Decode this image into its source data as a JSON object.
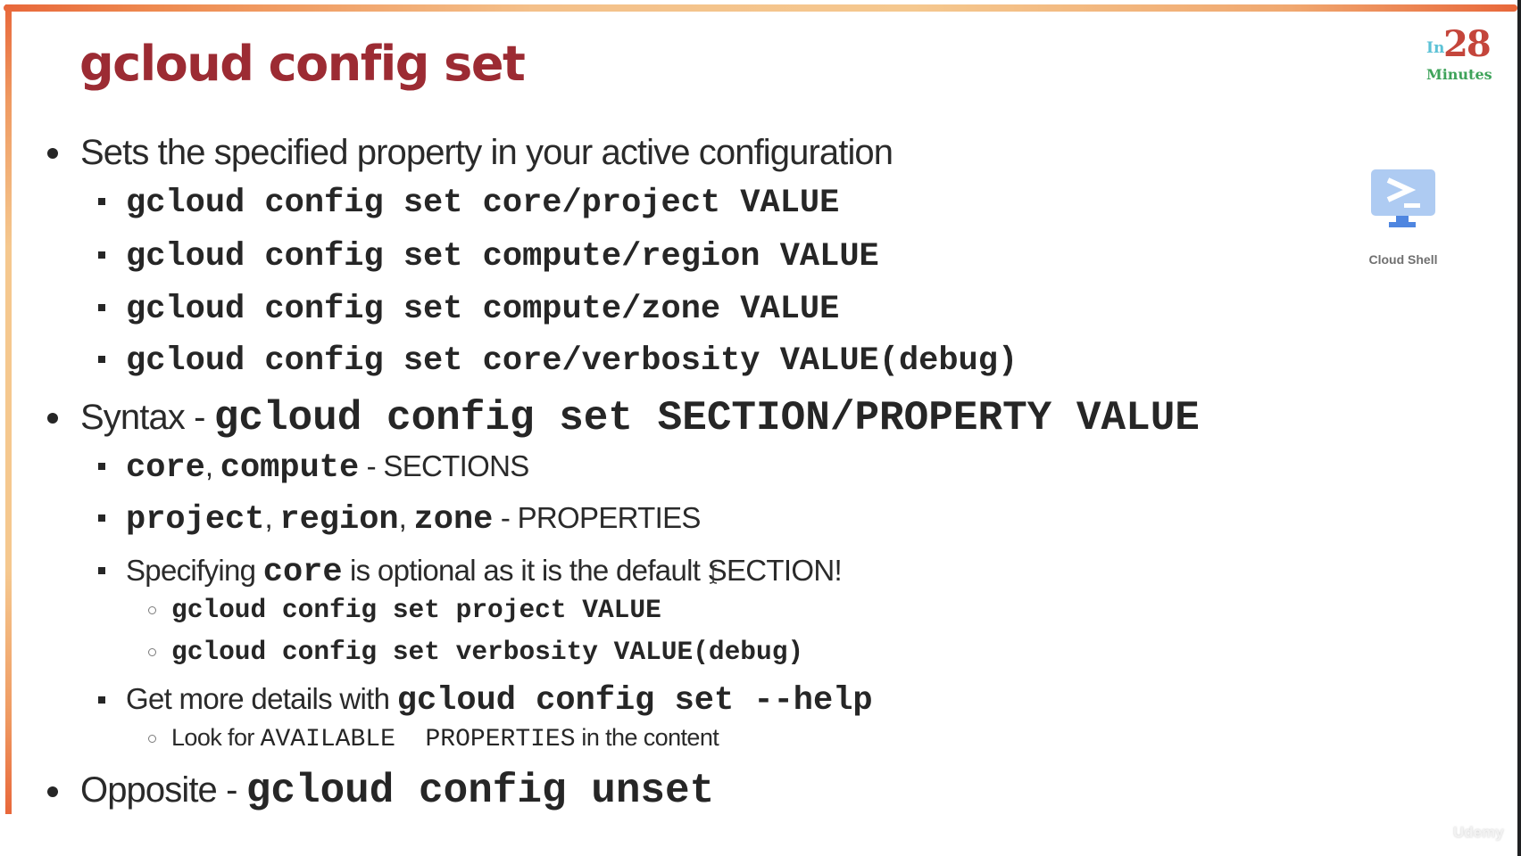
{
  "slide": {
    "title": "gcloud config set",
    "logo": {
      "prefix": "In",
      "number": "28",
      "suffix": "Minutes"
    },
    "cloud_shell": {
      "icon": "cloud-shell-terminal-icon",
      "label": "Cloud Shell"
    },
    "watermark": "Udemy",
    "colors": {
      "title": "#9c2b33",
      "border_orange": "#e8673a",
      "border_peach": "#f5c88f",
      "logo_in": "#5cc2d6",
      "logo_number": "#c4453b",
      "logo_minutes": "#3ea35a",
      "cloud_shell_screen": "#aecbf2",
      "cloud_shell_stand": "#4f86e0"
    },
    "bullets": [
      {
        "text": "Sets the specified property in your active configuration",
        "children": [
          {
            "code": "gcloud config set core/project VALUE"
          },
          {
            "code": "gcloud config set compute/region VALUE"
          },
          {
            "code": "gcloud config set compute/zone VALUE"
          },
          {
            "code": "gcloud config set core/verbosity VALUE(debug)"
          }
        ]
      },
      {
        "text": "Syntax - ",
        "code": "gcloud config set SECTION/PROPERTY VALUE",
        "children": [
          {
            "code_parts": [
              "core",
              ", ",
              "compute"
            ],
            "text": " - SECTIONS"
          },
          {
            "code_parts": [
              "project",
              ", ",
              "region",
              ", ",
              "zone"
            ],
            "text": " - PROPERTIES"
          },
          {
            "text_before": "Specifying ",
            "code": "core",
            "text_after": " is optional as it is the default SECTION!",
            "children": [
              {
                "code": "gcloud config set project VALUE"
              },
              {
                "code": "gcloud config set verbosity VALUE(debug)"
              }
            ]
          },
          {
            "text": "Get more details with ",
            "code": "gcloud config set --help",
            "children": [
              {
                "text_before": "Look for ",
                "code": "AVAILABLE  PROPERTIES",
                "text_after": " in the content"
              }
            ]
          }
        ]
      },
      {
        "text": "Opposite - ",
        "code": "gcloud config unset"
      }
    ]
  }
}
